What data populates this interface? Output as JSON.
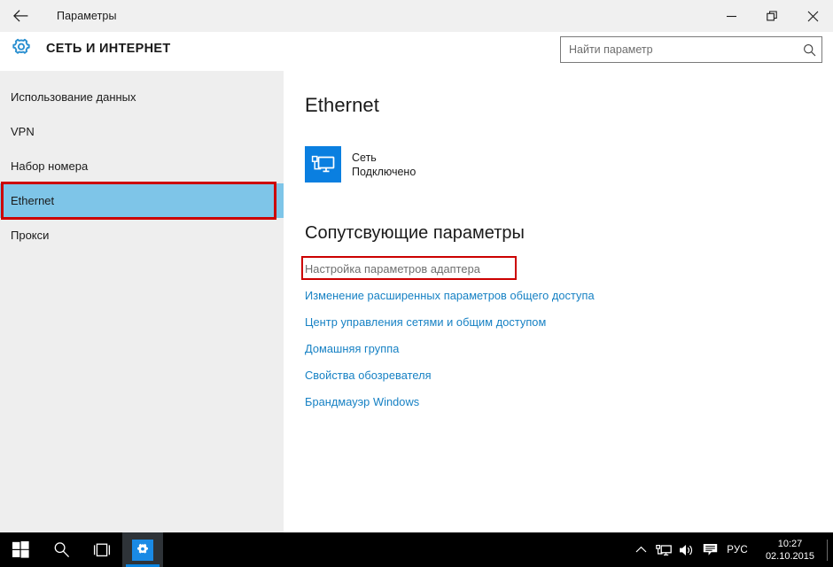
{
  "window": {
    "title": "Параметры",
    "back_icon": "back-arrow-icon",
    "minimize_icon": "minimize-icon",
    "restore_icon": "restore-icon",
    "close_icon": "close-icon"
  },
  "header": {
    "gear_icon": "gear-icon",
    "category": "СЕТЬ И ИНТЕРНЕТ"
  },
  "search": {
    "placeholder": "Найти параметр",
    "value": "",
    "icon": "search-icon"
  },
  "sidebar": {
    "items": [
      {
        "label": "Использование данных",
        "selected": false,
        "annotated": false
      },
      {
        "label": "VPN",
        "selected": false,
        "annotated": false
      },
      {
        "label": "Набор номера",
        "selected": false,
        "annotated": false
      },
      {
        "label": "Ethernet",
        "selected": true,
        "annotated": true
      },
      {
        "label": "Прокси",
        "selected": false,
        "annotated": false
      }
    ]
  },
  "main": {
    "heading": "Ethernet",
    "network": {
      "icon": "ethernet-network-icon",
      "name": "Сеть",
      "state": "Подключено"
    },
    "related_heading": "Сопутсвующие параметры",
    "links": [
      {
        "label": "Настройка параметров адаптера",
        "style": "muted",
        "annotated": true
      },
      {
        "label": "Изменение расширенных параметров общего доступа",
        "style": "link",
        "annotated": false
      },
      {
        "label": "Центр управления сетями и общим доступом",
        "style": "link",
        "annotated": false
      },
      {
        "label": "Домашняя группа",
        "style": "link",
        "annotated": false
      },
      {
        "label": "Свойства обозревателя",
        "style": "link",
        "annotated": false
      },
      {
        "label": "Брандмауэр Windows",
        "style": "link",
        "annotated": false
      }
    ]
  },
  "taskbar": {
    "start_icon": "windows-start-icon",
    "search_icon": "taskbar-search-icon",
    "taskview_icon": "task-view-icon",
    "settings_icon": "settings-gear-icon",
    "tray": {
      "chevron_icon": "chevron-up-icon",
      "network_icon": "network-tray-icon",
      "volume_icon": "volume-icon",
      "action_center_icon": "action-center-icon",
      "language": "РУС",
      "time": "10:27",
      "date": "02.10.2015"
    }
  },
  "colors": {
    "accent": "#0a7fe0",
    "link": "#1681c4",
    "selection": "#7ec5e8",
    "annotation": "#cc0000"
  }
}
